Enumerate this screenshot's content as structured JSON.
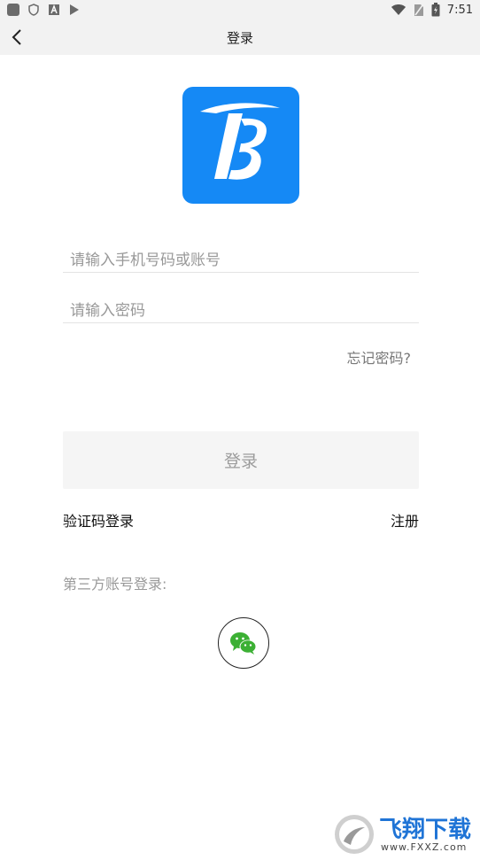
{
  "status_bar": {
    "time": "7:51",
    "left_icons": [
      "app-square-icon",
      "shield-icon",
      "a-icon",
      "play-store-icon"
    ],
    "right_icons": [
      "wifi-icon",
      "sim-icon",
      "battery-icon"
    ]
  },
  "nav": {
    "title": "登录",
    "back_icon": "chevron-left-icon"
  },
  "logo": {
    "letter": "B",
    "color": "#1589f5"
  },
  "form": {
    "phone_placeholder": "请输入手机号码或账号",
    "phone_value": "",
    "password_placeholder": "请输入密码",
    "password_value": "",
    "forgot_label": "忘记密码?"
  },
  "actions": {
    "login_label": "登录",
    "sms_login_label": "验证码登录",
    "register_label": "注册"
  },
  "third_party": {
    "label": "第三方账号登录:",
    "providers": [
      {
        "name": "wechat",
        "icon": "wechat-icon",
        "color": "#3cb034"
      }
    ]
  },
  "watermark": {
    "text": "飞翔下载",
    "sub": "www.FXXZ.com"
  }
}
